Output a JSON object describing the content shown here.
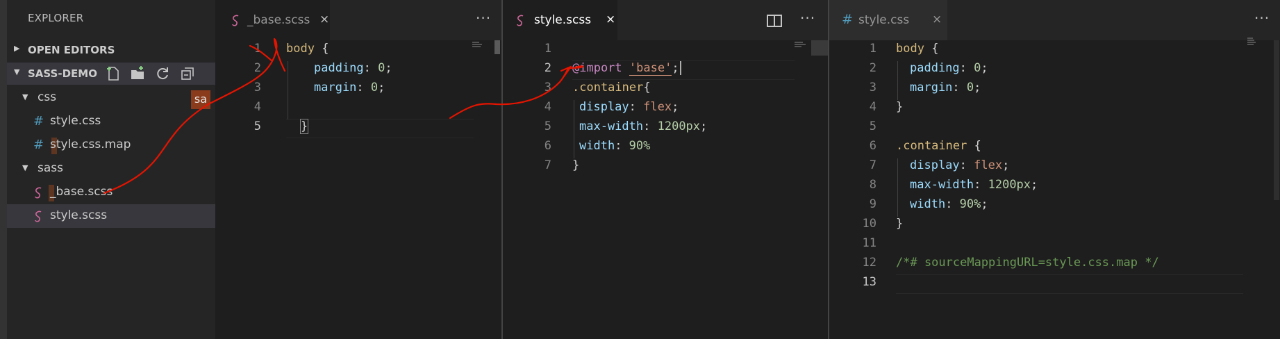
{
  "sidebar": {
    "title": "EXPLORER",
    "open_editors": "OPEN EDITORS",
    "project": "SASS-DEMO",
    "hover_badge": "sa",
    "tree": [
      {
        "label": "css",
        "type": "folder"
      },
      {
        "label": "style.css",
        "type": "css"
      },
      {
        "label": "style.css.map",
        "type": "css"
      },
      {
        "label": "sass",
        "type": "folder"
      },
      {
        "label": "_base.scss",
        "type": "scss"
      },
      {
        "label": "style.scss",
        "type": "scss"
      }
    ],
    "icons": [
      "new-file-icon",
      "new-folder-icon",
      "refresh-icon",
      "collapse-all-icon"
    ]
  },
  "groups": {
    "base": {
      "tab_label": "_base.scss",
      "close": "×",
      "more": "···",
      "lines": [
        "1",
        "2",
        "3",
        "4",
        "5"
      ]
    },
    "style_scss": {
      "tab_label": "style.scss",
      "close": "×",
      "more": "···",
      "lines": [
        "1",
        "2",
        "3",
        "4",
        "5",
        "6",
        "7"
      ]
    },
    "style_css": {
      "tab_label": "style.css",
      "close": "×",
      "more": "···",
      "lines": [
        "1",
        "2",
        "3",
        "4",
        "5",
        "6",
        "7",
        "8",
        "9",
        "10",
        "11",
        "12",
        "13"
      ]
    }
  },
  "code": {
    "body": "body",
    "brace_open": " {",
    "brace_close": "}",
    "padding": "padding",
    "margin": "margin",
    "colon": ": ",
    "zero": "0",
    "semi": ";",
    "at_import": "@import",
    "base_str": "'base'",
    "container": ".container",
    "display": "display",
    "flex": "flex",
    "max_width": "max-width",
    "px1200": "1200px",
    "width": "width",
    "pct90": "90%",
    "comment": "/*# sourceMappingURL=style.css.map */"
  },
  "colors": {
    "annotation": "#e51400",
    "scss_icon": "#cd6799",
    "css_icon": "#519aba"
  }
}
